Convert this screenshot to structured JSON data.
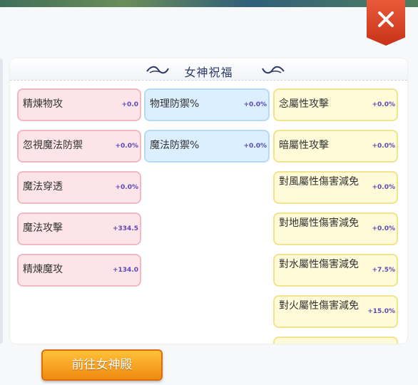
{
  "header": {
    "title": "女神祝福"
  },
  "columns": {
    "left": [
      {
        "label": "精煉物攻",
        "value": "+0.0"
      },
      {
        "label": "忽視魔法防禦",
        "value": "+0.0%"
      },
      {
        "label": "魔法穿透",
        "value": "+0.0%"
      },
      {
        "label": "魔法攻擊",
        "value": "+334.5"
      },
      {
        "label": "精煉魔攻",
        "value": "+134.0"
      }
    ],
    "middle": [
      {
        "label": "物理防禦%",
        "value": "+0.0%"
      },
      {
        "label": "魔法防禦%",
        "value": "+0.0%"
      }
    ],
    "right": [
      {
        "label": "念屬性攻擊",
        "value": "+0.0%"
      },
      {
        "label": "暗屬性攻擊",
        "value": "+0.0%"
      },
      {
        "label": "對風屬性傷害減免",
        "value": "+0.0%"
      },
      {
        "label": "對地屬性傷害減免",
        "value": "+0.0%"
      },
      {
        "label": "對水屬性傷害減免",
        "value": "+7.5%"
      },
      {
        "label": "對火屬性傷害減免",
        "value": "+15.0%"
      }
    ]
  },
  "footer": {
    "button_label": "前往女神殿"
  },
  "icons": {
    "close": "close-icon",
    "ornament": "flourish-ornament-icon"
  },
  "colors": {
    "accent_close": "#d9411f",
    "button_orange": "#f5a623",
    "pink_card": "#fce4e8",
    "blue_card": "#dcefff",
    "yellow_card": "#fffbd9",
    "value_text": "#5a4ab8"
  }
}
